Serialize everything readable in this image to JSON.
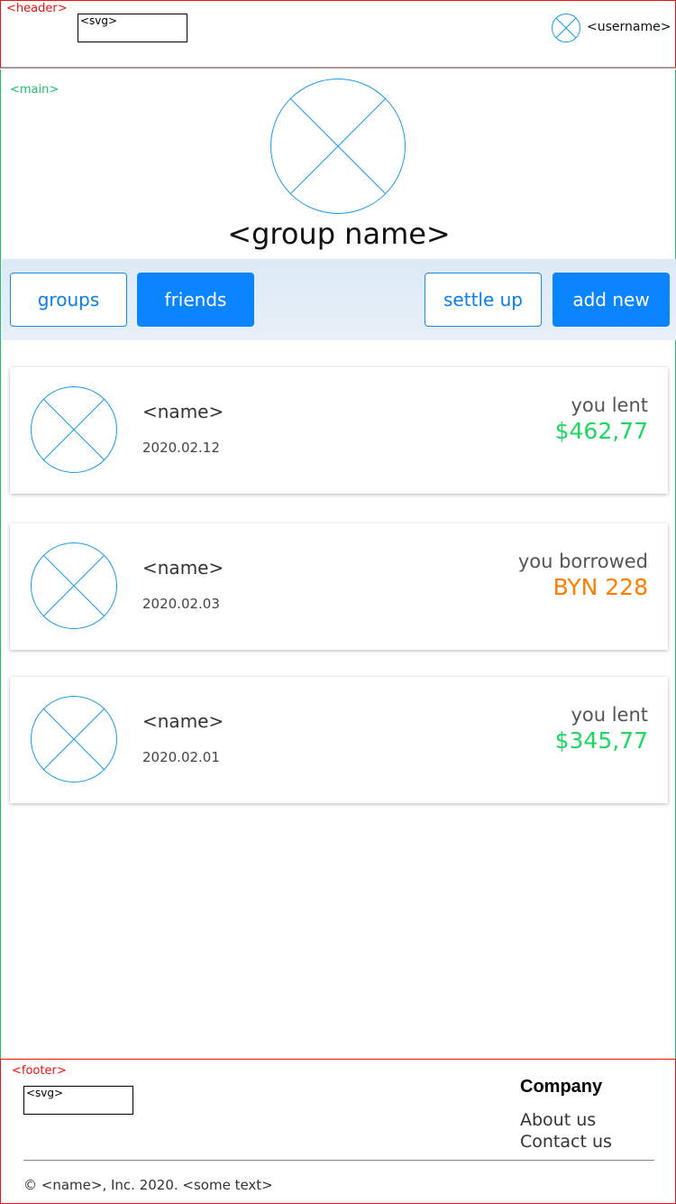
{
  "header": {
    "tag": "<header>",
    "logo_placeholder": "<svg>",
    "username": "<username>",
    "user_icon": "avatar-placeholder-icon"
  },
  "main": {
    "tag": "<main>",
    "group_icon": "group-image-placeholder-icon",
    "group_name": "<group name>",
    "tabs": [
      {
        "label": "groups",
        "active": false
      },
      {
        "label": "friends",
        "active": true
      }
    ],
    "actions": {
      "settle_up": "settle up",
      "add_new": "add new"
    },
    "entries": [
      {
        "name": "<name>",
        "date": "2020.02.12",
        "status": "you lent",
        "amount": "$462,77",
        "amount_color": "#1ed760"
      },
      {
        "name": "<name>",
        "date": "2020.02.03",
        "status": "you borrowed",
        "amount": "BYN 228",
        "amount_color": "#ff7d00"
      },
      {
        "name": "<name>",
        "date": "2020.02.01",
        "status": "you lent",
        "amount": "$345,77",
        "amount_color": "#1ed760"
      }
    ]
  },
  "footer": {
    "tag": "<footer>",
    "logo_placeholder": "<svg>",
    "company_heading": "Company",
    "links": [
      "About us",
      "Contact us"
    ],
    "copyright": "© <name>, Inc. 2020. <some text>"
  },
  "colors": {
    "accent": "#0a84ff",
    "lent": "#1ed760",
    "borrowed": "#ff7d00",
    "header_border": "#ee1111",
    "main_border": "#1cbf6e"
  }
}
